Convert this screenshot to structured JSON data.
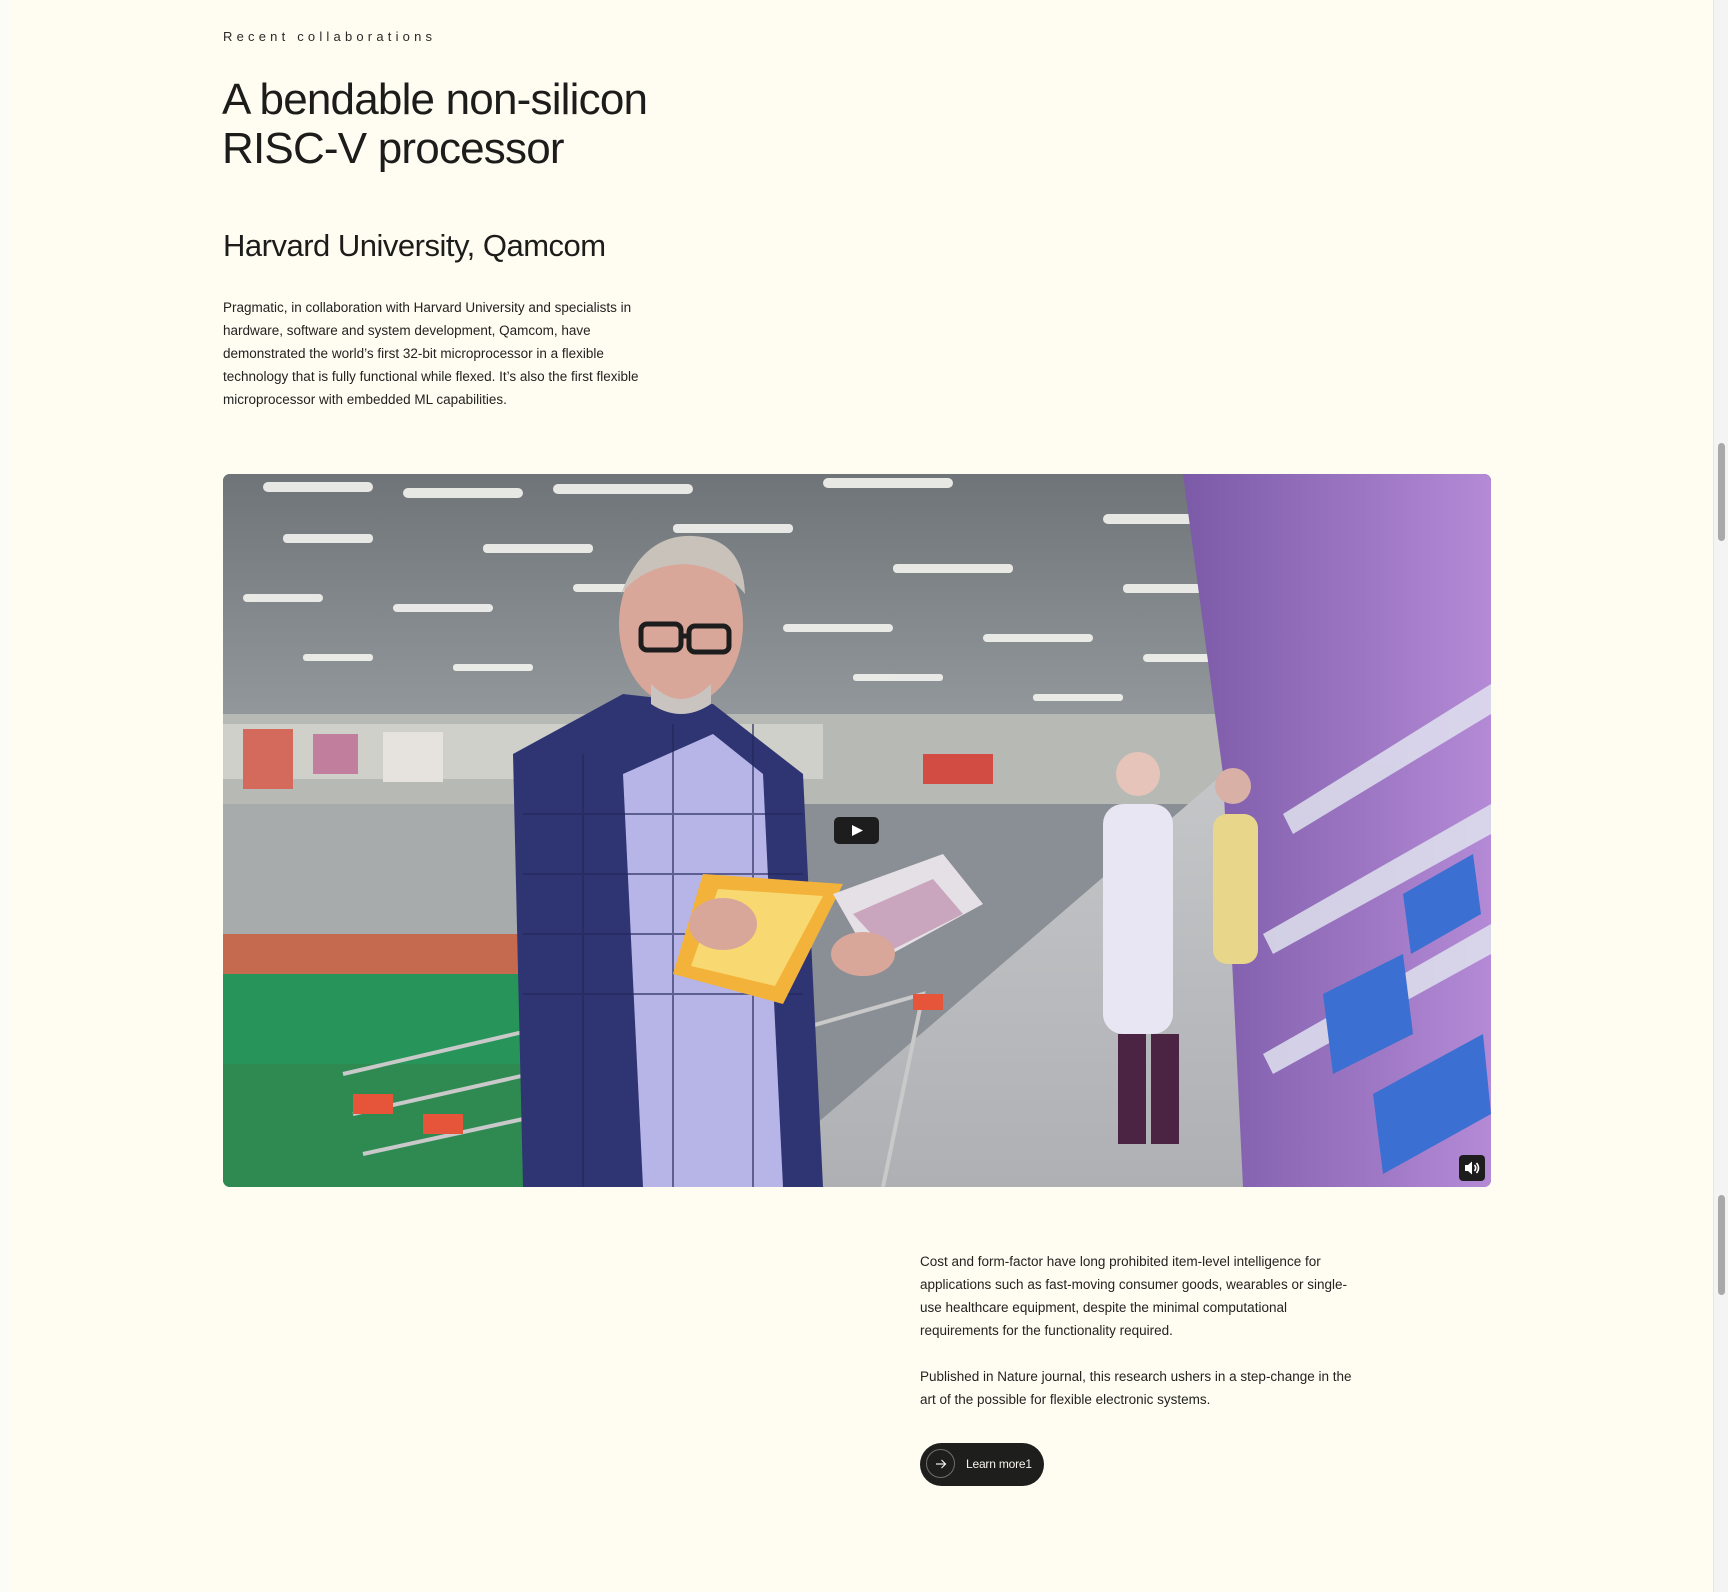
{
  "section": {
    "eyebrow": "Recent collaborations",
    "title_line1": "A bendable non-silicon",
    "title_line2": "RISC-V processor",
    "partners": "Harvard University, Qamcom",
    "intro": "Pragmatic, in collaboration with Harvard University and specialists in hardware, software and system development, Qamcom, have demonstrated the world’s first 32-bit microprocessor in a flexible technology that is fully functional while flexed. It’s also the first flexible microprocessor with embedded ML capabilities."
  },
  "video": {
    "poster_description": "Man in a supermarket examining packaged food while holding a shopping cart",
    "play_icon": "play-icon",
    "volume_icon": "volume-icon"
  },
  "details": {
    "paragraph1": "Cost and form-factor have long prohibited item-level intelligence for applications such as fast-moving consumer goods, wearables or single-use healthcare equipment, despite the minimal computational requirements for the functionality required.",
    "paragraph2": "Published in Nature journal, this research ushers in a step-change in the art of the possible for flexible electronic systems."
  },
  "cta": {
    "label": "Learn more1",
    "icon": "arrow-right-icon"
  },
  "colors": {
    "page_background": "#fffdf2",
    "text": "#1e1e1c",
    "button_background": "#1e1e1c"
  }
}
